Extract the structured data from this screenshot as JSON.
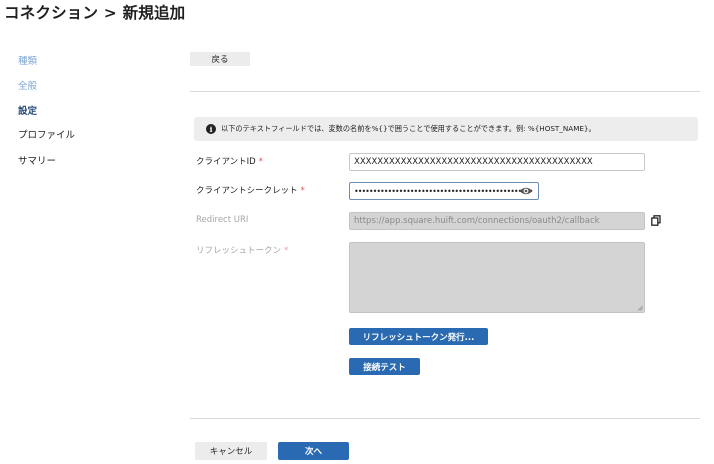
{
  "header": {
    "title": "コネクション > 新規追加"
  },
  "sidebar": {
    "items": [
      {
        "label": "種類",
        "state": "done"
      },
      {
        "label": "全般",
        "state": "done"
      },
      {
        "label": "設定",
        "state": "active"
      },
      {
        "label": "プロファイル",
        "state": "todo"
      },
      {
        "label": "サマリー",
        "state": "todo"
      }
    ]
  },
  "toolbar": {
    "back_label": "戻る"
  },
  "info": {
    "text": "以下のテキストフィールドでは、変数の名前を%{}で囲うことで使用することができます。例: %{HOST_NAME}。"
  },
  "form": {
    "client_id": {
      "label": "クライアントID",
      "required_mark": "*",
      "value": "XXXXXXXXXXXXXXXXXXXXXXXXXXXXXXXXXXXXXXXXX"
    },
    "client_secret": {
      "label": "クライアントシークレット",
      "required_mark": "*",
      "value": "••••••••••••••••••••••••••••••••••••••••••••••••"
    },
    "redirect_uri": {
      "label": "Redirect URI",
      "value": "https://app.square.huift.com/connections/oauth2/callback"
    },
    "refresh_token": {
      "label": "リフレッシュトークン",
      "required_mark": "*",
      "value": ""
    },
    "issue_token_button": "リフレッシュトークン発行...",
    "test_button": "接続テスト"
  },
  "footer": {
    "cancel_label": "キャンセル",
    "next_label": "次へ"
  },
  "colors": {
    "primary": "#2a6ab3",
    "required": "#d9534f",
    "nav_done": "#7da7d3",
    "nav_active": "#2c4f7c"
  }
}
